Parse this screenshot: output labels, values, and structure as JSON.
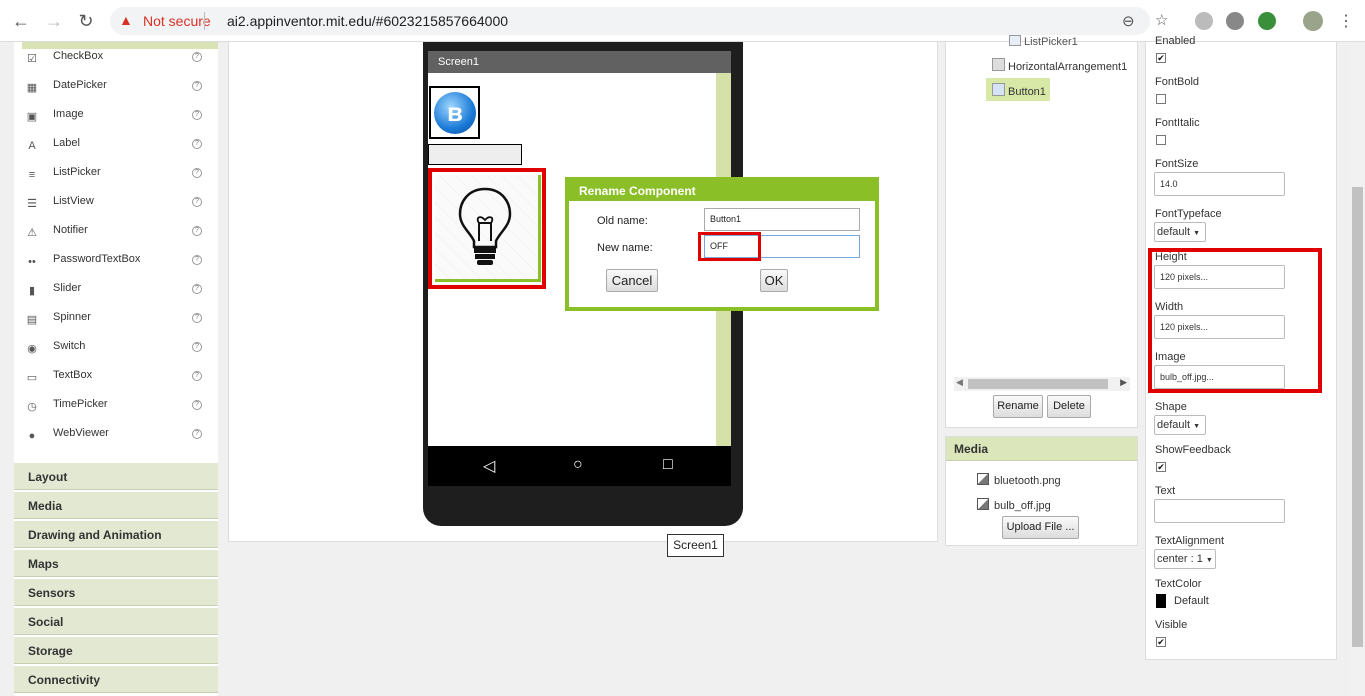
{
  "browser": {
    "security": "Not secure",
    "url": "ai2.appinventor.mit.edu/#6023215857664000"
  },
  "palette": {
    "items": [
      {
        "label": "CheckBox",
        "icon": "checkbox-icon"
      },
      {
        "label": "DatePicker",
        "icon": "calendar-icon"
      },
      {
        "label": "Image",
        "icon": "image-icon"
      },
      {
        "label": "Label",
        "icon": "label-icon"
      },
      {
        "label": "ListPicker",
        "icon": "listpicker-icon"
      },
      {
        "label": "ListView",
        "icon": "listview-icon"
      },
      {
        "label": "Notifier",
        "icon": "warning-icon"
      },
      {
        "label": "PasswordTextBox",
        "icon": "password-icon"
      },
      {
        "label": "Slider",
        "icon": "slider-icon"
      },
      {
        "label": "Spinner",
        "icon": "spinner-icon"
      },
      {
        "label": "Switch",
        "icon": "switch-icon"
      },
      {
        "label": "TextBox",
        "icon": "textbox-icon"
      },
      {
        "label": "TimePicker",
        "icon": "clock-icon"
      },
      {
        "label": "WebViewer",
        "icon": "globe-icon"
      }
    ],
    "help_glyph": "?",
    "categories": [
      "Layout",
      "Media",
      "Drawing and Animation",
      "Maps",
      "Sensors",
      "Social",
      "Storage",
      "Connectivity"
    ]
  },
  "viewer": {
    "screen_title": "Screen1",
    "screen_label": "Screen1"
  },
  "dialog": {
    "title": "Rename Component",
    "old_name_label": "Old name:",
    "old_name_value": "Button1",
    "new_name_label": "New name:",
    "new_name_value": "OFF",
    "cancel": "Cancel",
    "ok": "OK"
  },
  "components": {
    "nodes": [
      "ListPicker1",
      "HorizontalArrangement1",
      "Button1"
    ],
    "selected": "Button1",
    "rename": "Rename",
    "delete": "Delete"
  },
  "media": {
    "title": "Media",
    "files": [
      "bluetooth.png",
      "bulb_off.jpg"
    ],
    "upload": "Upload File ..."
  },
  "properties": {
    "enabled_label": "Enabled",
    "enabled": true,
    "fontbold_label": "FontBold",
    "fontbold": false,
    "fontitalic_label": "FontItalic",
    "fontitalic": false,
    "fontsize_label": "FontSize",
    "fontsize": "14.0",
    "fonttypeface_label": "FontTypeface",
    "fonttypeface": "default",
    "height_label": "Height",
    "height": "120 pixels...",
    "width_label": "Width",
    "width": "120 pixels...",
    "image_label": "Image",
    "image": "bulb_off.jpg...",
    "shape_label": "Shape",
    "shape": "default",
    "showfeedback_label": "ShowFeedback",
    "showfeedback": true,
    "text_label": "Text",
    "text": "",
    "textalignment_label": "TextAlignment",
    "textalignment": "center : 1",
    "textcolor_label": "TextColor",
    "textcolor": "Default",
    "visible_label": "Visible",
    "visible": true,
    "check_glyph": "✔"
  },
  "colors": {
    "accent": "#8bbf27",
    "highlight": "#e00000"
  }
}
